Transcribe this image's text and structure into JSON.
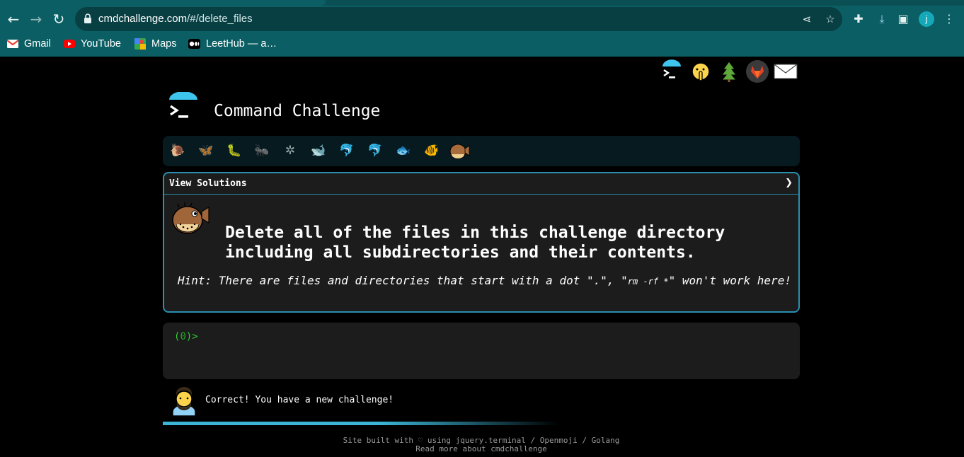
{
  "browser": {
    "url_host": "cmdchallenge.com",
    "url_path": "/#/delete_files",
    "bookmarks": [
      {
        "label": "Gmail",
        "icon": "gmail-icon"
      },
      {
        "label": "YouTube",
        "icon": "youtube-icon"
      },
      {
        "label": "Maps",
        "icon": "maps-icon"
      },
      {
        "label": "LeetHub — a…",
        "icon": "leethub-icon"
      }
    ],
    "profile_initial": "j"
  },
  "site": {
    "title": "Command Challenge",
    "corner_icons": [
      "terminal-logo-icon",
      "shushing-face-icon",
      "tree-icon",
      "gitlab-icon",
      "mail-icon"
    ],
    "progress_icons": [
      "snail-icon",
      "butterfly-icon",
      "caterpillar-icon",
      "ant-icon",
      "spider-web-icon",
      "whale-icon",
      "dolphin-icon",
      "dolphin-icon",
      "fish-icon",
      "tropical-fish-icon",
      "pufferfish-icon"
    ]
  },
  "challenge": {
    "view_solutions": "View Solutions",
    "chevron": "❯",
    "task_line1": "Delete all of the files in this challenge directory",
    "task_line2": "including all subdirectories and their contents.",
    "hint_prefix": "Hint: There are files and directories that start with a dot \".\", \"",
    "hint_code": "rm -rf *",
    "hint_suffix": "\" won't work here!"
  },
  "terminal": {
    "prompt_open": "(",
    "prompt_num": "0",
    "prompt_close": ")>"
  },
  "feedback": {
    "message": "Correct! You have a new challenge!"
  },
  "footer": {
    "line1": "Site built with ♡ using jquery.terminal / Openmoji / Golang",
    "line2": "Read more about cmdchallenge"
  },
  "colors": {
    "browser_teal": "#0b5e63",
    "accent_blue": "#2a8fb0",
    "prompt_green": "#33cc33",
    "background": "#000000"
  }
}
